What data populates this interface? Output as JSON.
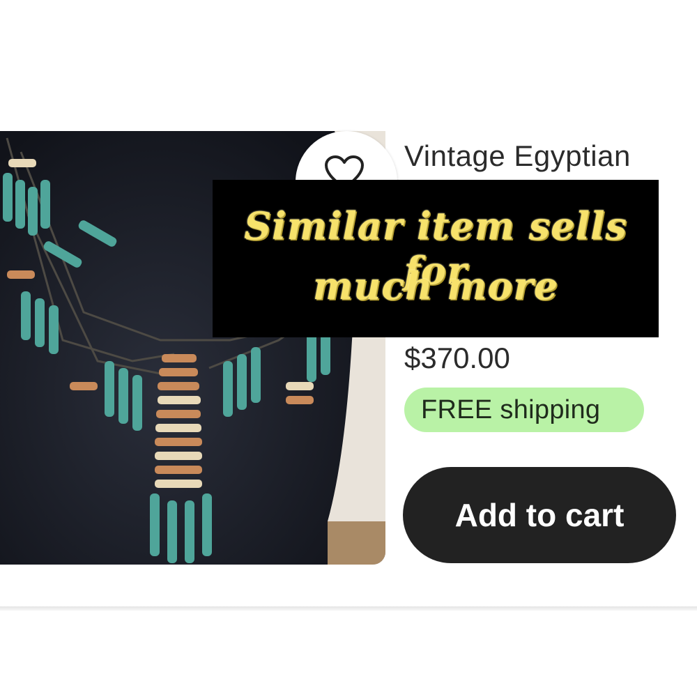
{
  "listing": {
    "title": "Vintage Egyptian",
    "price": "$370.00",
    "shipping_badge": "FREE shipping",
    "add_to_cart_label": "Add to cart",
    "favorite_icon": "heart-outline-icon",
    "image_subject": "beaded bib necklace on black display bust"
  },
  "overlay": {
    "line1": "Similar item sells for",
    "line2": "much more"
  },
  "colors": {
    "overlay_background": "#000000",
    "overlay_text": "#f7e26b",
    "shipping_badge_background": "#b9f2a6",
    "button_background": "#222222",
    "button_text": "#ffffff"
  }
}
